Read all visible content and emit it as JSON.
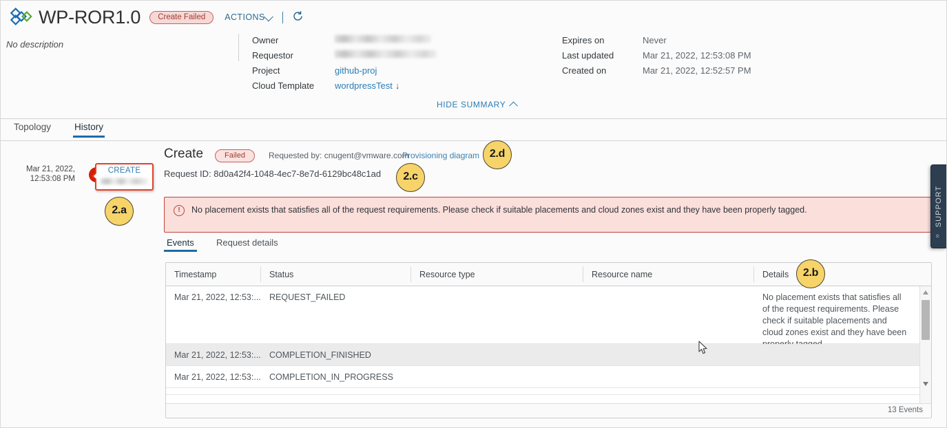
{
  "header": {
    "app_title": "WP-ROR1.0",
    "status_badge": "Create Failed",
    "actions_label": "ACTIONS",
    "refresh_icon": "refresh-icon",
    "description": "No description",
    "hide_summary_label": "HIDE SUMMARY",
    "meta_left": [
      {
        "label": "Owner",
        "value": "",
        "blurred": true,
        "blur_width": 140,
        "link": false
      },
      {
        "label": "Requestor",
        "value": "",
        "blurred": true,
        "blur_width": 148,
        "link": false
      },
      {
        "label": "Project",
        "value": "github-proj",
        "blurred": false,
        "link": true
      },
      {
        "label": "Cloud Template",
        "value": "wordpressTest",
        "blurred": false,
        "link": true,
        "download": true
      }
    ],
    "meta_right": [
      {
        "label": "Expires on",
        "value": "Never"
      },
      {
        "label": "Last updated",
        "value": "Mar 21, 2022, 12:53:08 PM"
      },
      {
        "label": "Created on",
        "value": "Mar 21, 2022, 12:52:57 PM"
      }
    ]
  },
  "page_tabs": [
    {
      "label": "Topology",
      "active": false
    },
    {
      "label": "History",
      "active": true
    }
  ],
  "timeline": {
    "timestamp_line1": "Mar 21, 2022,",
    "timestamp_line2": "12:53:08 PM",
    "error_icon": "error-exclamation-icon",
    "callout_label": "CREATE"
  },
  "detail": {
    "title": "Create",
    "status_badge": "Failed",
    "requested_by": "Requested by: cnugent@vmware.com",
    "provisioning_diagram_link": "Provisioning diagram",
    "request_id": "Request ID: 8d0a42f4-1048-4ec7-8e7d-6129bc48c1ad"
  },
  "alert": {
    "icon": "error-circle-icon",
    "message": "No placement exists that satisfies all of the request requirements. Please check if suitable placements and cloud zones exist and they have been properly tagged."
  },
  "inner_tabs": [
    {
      "label": "Events",
      "active": true
    },
    {
      "label": "Request details",
      "active": false
    }
  ],
  "table": {
    "columns": [
      "Timestamp",
      "Status",
      "Resource type",
      "Resource name",
      "Details"
    ],
    "rows": [
      {
        "timestamp": "Mar 21, 2022, 12:53:...",
        "status": "REQUEST_FAILED",
        "resource_type": "",
        "resource_name": "",
        "details": "No placement exists that satisfies all of the request requirements. Please check if suitable placements and cloud zones exist and they have been properly tagged."
      },
      {
        "timestamp": "Mar 21, 2022, 12:53:...",
        "status": "COMPLETION_FINISHED",
        "resource_type": "",
        "resource_name": "",
        "details": ""
      },
      {
        "timestamp": "Mar 21, 2022, 12:53:...",
        "status": "COMPLETION_IN_PROGRESS",
        "resource_type": "",
        "resource_name": "",
        "details": ""
      }
    ],
    "footer_count": "13 Events"
  },
  "support_tab": {
    "label": "SUPPORT",
    "chevron_icon": "chevron-double-left-icon"
  },
  "callouts": [
    {
      "id": "a",
      "label": "2.a"
    },
    {
      "id": "b",
      "label": "2.b"
    },
    {
      "id": "c",
      "label": "2.c"
    },
    {
      "id": "d",
      "label": "2.d"
    }
  ],
  "colors": {
    "accent_blue": "#2b7cb5",
    "error_red": "#c0443a",
    "error_dot": "#d81e05",
    "callout_yellow": "#f7d469",
    "support_navy": "#2c3e4f"
  }
}
